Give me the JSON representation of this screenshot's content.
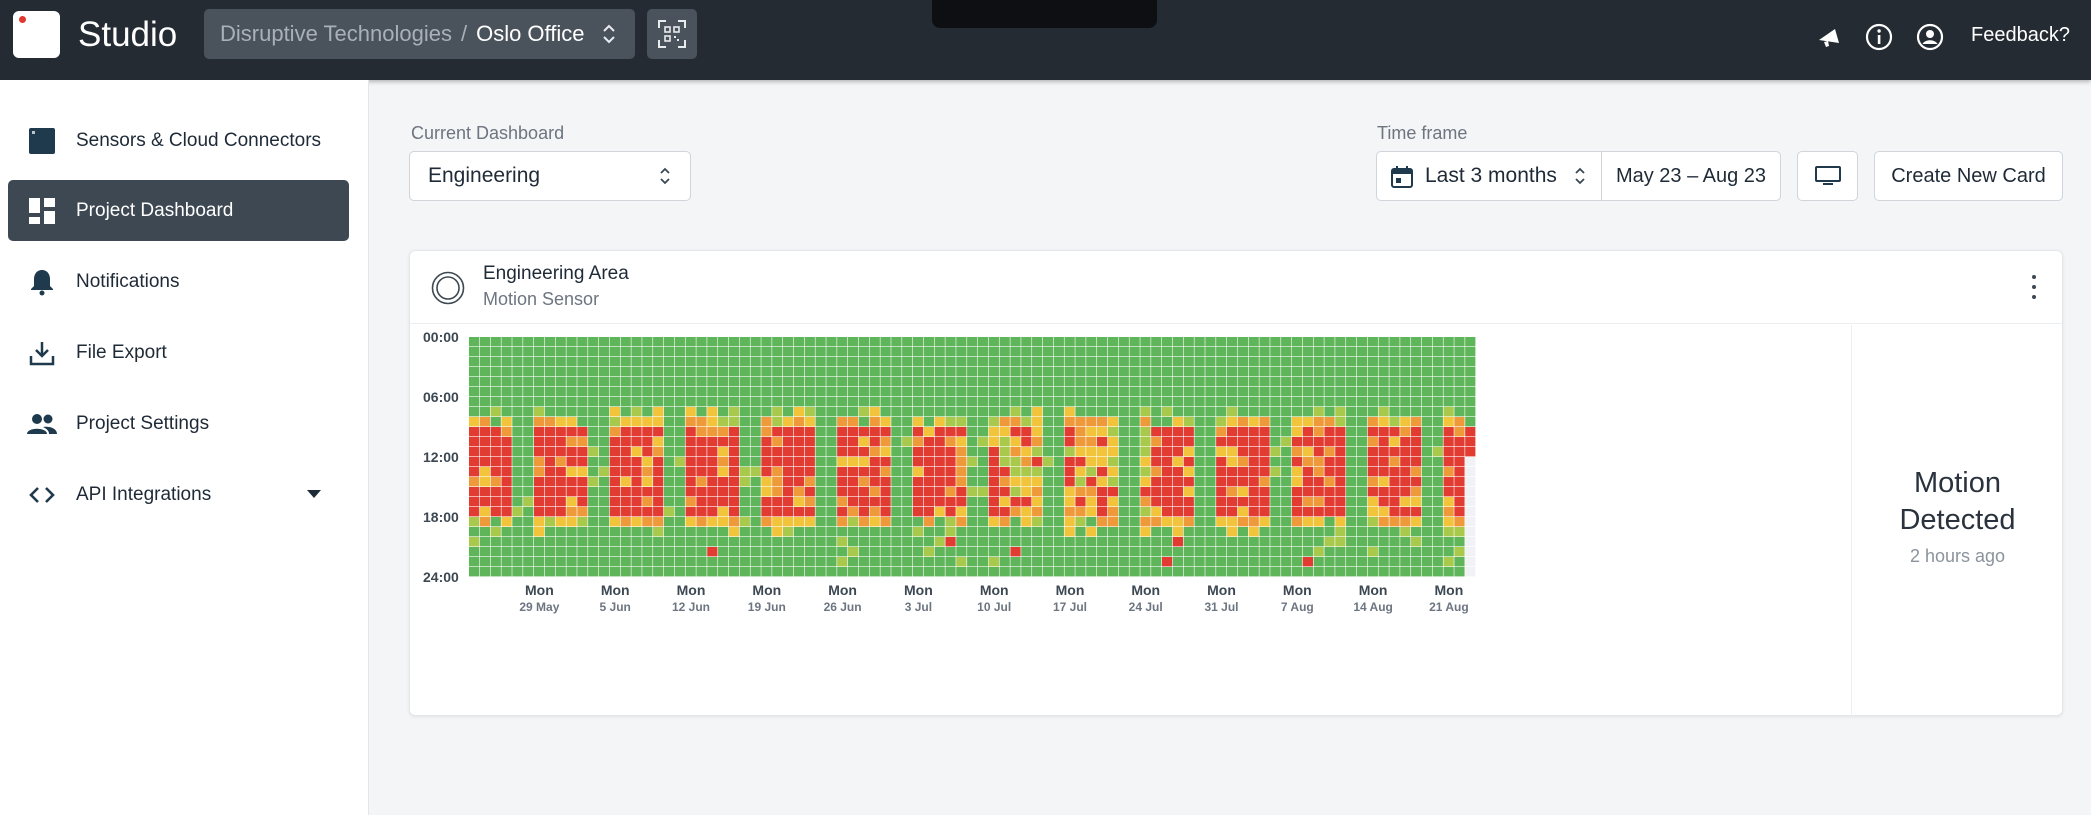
{
  "topbar": {
    "app_title": "Studio",
    "organization": "Disruptive Technologies",
    "separator": "/",
    "project": "Oslo Office",
    "scan_icon": "qr-scan-icon",
    "icons": [
      "announcement-icon",
      "info-icon",
      "account-icon"
    ],
    "feedback_label": "Feedback?"
  },
  "sidebar": {
    "items": [
      {
        "label": "Sensors & Cloud Connectors",
        "icon": "sensor-icon",
        "active": false
      },
      {
        "label": "Project Dashboard",
        "icon": "dashboard-icon",
        "active": true
      },
      {
        "label": "Notifications",
        "icon": "bell-icon",
        "active": false
      },
      {
        "label": "File Export",
        "icon": "download-icon",
        "active": false
      },
      {
        "label": "Project Settings",
        "icon": "people-icon",
        "active": false
      },
      {
        "label": "API Integrations",
        "icon": "code-icon",
        "active": false,
        "expandable": true
      }
    ]
  },
  "dashboard": {
    "current_label": "Current Dashboard",
    "current_value": "Engineering",
    "timeframe_label": "Time frame",
    "timeframe_value": "Last 3 months",
    "date_range": "May 23 – Aug 23",
    "display_icon": "monitor-icon",
    "create_card_label": "Create New Card"
  },
  "card": {
    "title": "Engineering Area",
    "subtitle": "Motion Sensor",
    "icon": "motion-sensor-icon",
    "status_title": "Motion Detected",
    "status_time": "2 hours ago"
  },
  "colors": {
    "topbar": "#242b33",
    "sidebar_active": "#3d4852",
    "heat_none": "#5fb55a",
    "heat_low": "#a8c94c",
    "heat_mid": "#f2c43c",
    "heat_high": "#ef9a3a",
    "heat_max": "#e23b32",
    "heat_empty": "#f1f2f5"
  },
  "chart_data": {
    "type": "heatmap",
    "title": "",
    "y_ticks": [
      "00:00",
      "06:00",
      "12:00",
      "18:00",
      "24:00"
    ],
    "x_ticks": [
      {
        "day": "Mon",
        "date": "29 May"
      },
      {
        "day": "Mon",
        "date": "5 Jun"
      },
      {
        "day": "Mon",
        "date": "12 Jun"
      },
      {
        "day": "Mon",
        "date": "19 Jun"
      },
      {
        "day": "Mon",
        "date": "26 Jun"
      },
      {
        "day": "Mon",
        "date": "3 Jul"
      },
      {
        "day": "Mon",
        "date": "10 Jul"
      },
      {
        "day": "Mon",
        "date": "17 Jul"
      },
      {
        "day": "Mon",
        "date": "24 Jul"
      },
      {
        "day": "Mon",
        "date": "31 Jul"
      },
      {
        "day": "Mon",
        "date": "7 Aug"
      },
      {
        "day": "Mon",
        "date": "14 Aug"
      },
      {
        "day": "Mon",
        "date": "21 Aug"
      }
    ],
    "first_day": "2023-05-23",
    "days": 93,
    "hours": 24,
    "scale": [
      "none",
      "low",
      "medium",
      "high",
      "max"
    ],
    "weekly_intensity": [
      0.95,
      0.95,
      0.95,
      0.95,
      0.95,
      0.95,
      0.95,
      0.55,
      0.5,
      0.95,
      0.95,
      0.95,
      0.95,
      0.95
    ],
    "weekday_hours": "07:00–19:00 high activity, weekends none",
    "last_data_hour": 11
  }
}
